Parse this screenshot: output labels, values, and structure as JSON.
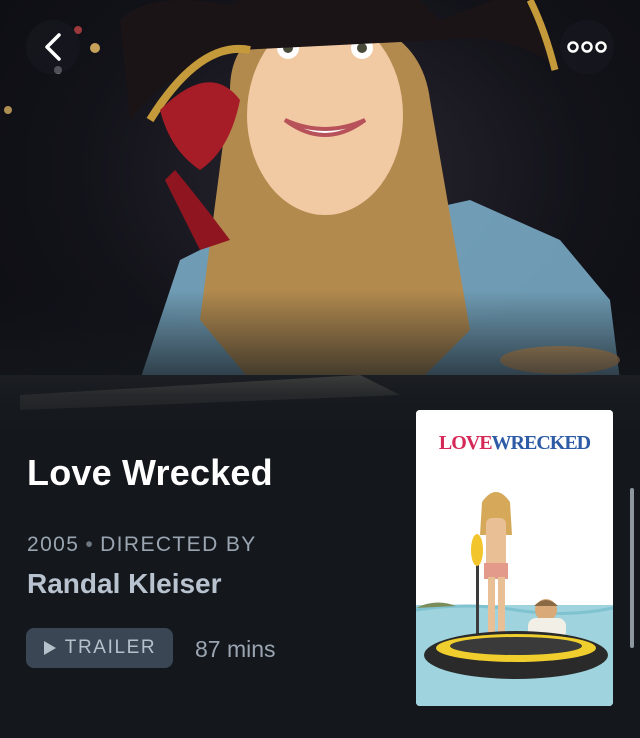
{
  "header": {
    "back_icon": "chevron-left-icon",
    "more_icon": "more-horizontal-icon"
  },
  "movie": {
    "title": "Love Wrecked",
    "year": "2005",
    "separator": "•",
    "directed_by_label": "DIRECTED BY",
    "director": "Randal Kleiser",
    "trailer_label": "TRAILER",
    "trailer_icon": "play-icon",
    "runtime": "87 mins"
  },
  "poster": {
    "title_part1": "LOVE",
    "title_part2": "WRECKED"
  },
  "colors": {
    "background": "#14181d",
    "trailer_button": "#3a4654",
    "meta_text": "#9aa5b1",
    "poster_love": "#d52a58",
    "poster_wrecked": "#2e5ba6"
  }
}
